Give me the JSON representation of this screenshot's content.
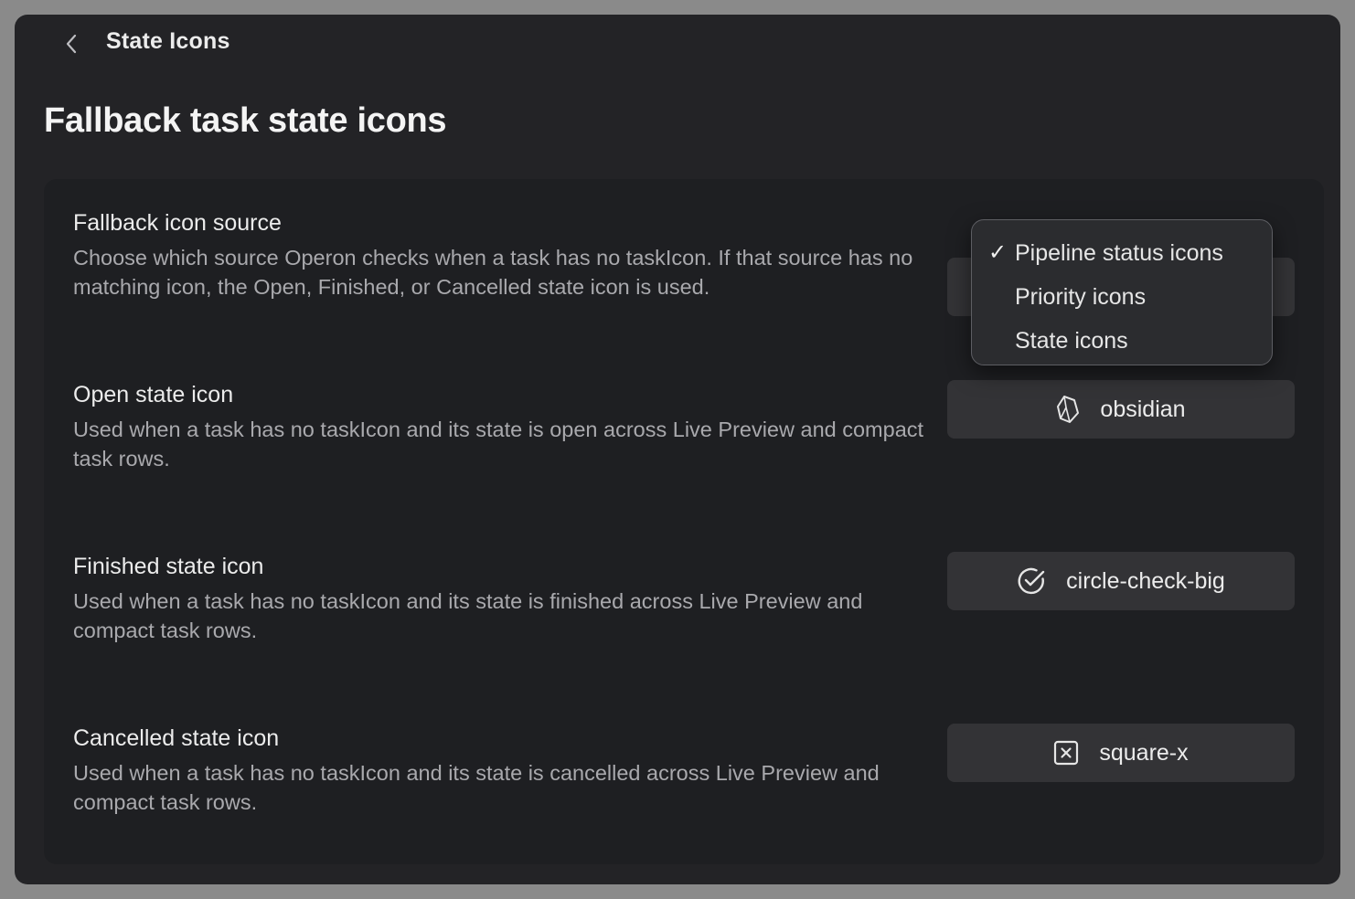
{
  "header": {
    "title": "State Icons"
  },
  "page_title": "Fallback task state icons",
  "settings": [
    {
      "name": "Fallback icon source",
      "description": "Choose which source Operon checks when a task has no taskIcon. If that source has no matching icon, the Open, Finished, or Cancelled state icon is used."
    },
    {
      "name": "Open state icon",
      "description": "Used when a task has no taskIcon and its state is open across Live Preview and compact task rows.",
      "icon_name": "obsidian",
      "icon": "obsidian-icon"
    },
    {
      "name": "Finished state icon",
      "description": "Used when a task has no taskIcon and its state is finished across Live Preview and compact task rows.",
      "icon_name": "circle-check-big",
      "icon": "circle-check-big-icon"
    },
    {
      "name": "Cancelled state icon",
      "description": "Used when a task has no taskIcon and its state is cancelled across Live Preview and compact task rows.",
      "icon_name": "square-x",
      "icon": "square-x-icon"
    }
  ],
  "dropdown": {
    "selected": "Pipeline status icons",
    "options": [
      "Pipeline status icons",
      "Priority icons",
      "State icons"
    ],
    "check": "✓"
  },
  "colors": {
    "window_bg": "#232326",
    "card_bg": "#1e1f22",
    "button_bg": "#333336",
    "text_primary": "#ececec",
    "text_muted": "#a9a9ad"
  }
}
